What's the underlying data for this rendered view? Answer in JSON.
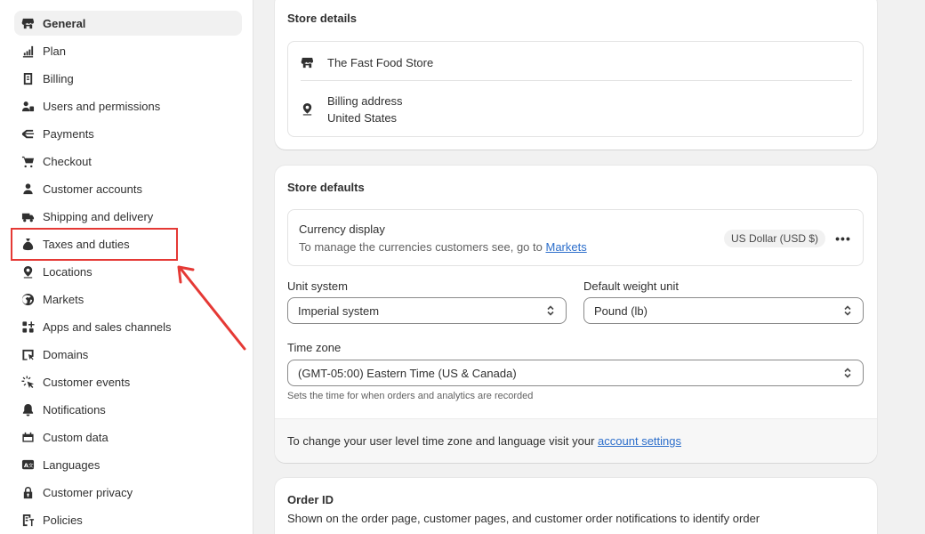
{
  "sidebar": {
    "items": [
      {
        "label": "General",
        "icon": "store-icon",
        "active": true
      },
      {
        "label": "Plan",
        "icon": "plan-chart-icon"
      },
      {
        "label": "Billing",
        "icon": "billing-icon"
      },
      {
        "label": "Users and permissions",
        "icon": "users-icon"
      },
      {
        "label": "Payments",
        "icon": "payments-icon"
      },
      {
        "label": "Checkout",
        "icon": "cart-icon"
      },
      {
        "label": "Customer accounts",
        "icon": "person-icon"
      },
      {
        "label": "Shipping and delivery",
        "icon": "truck-icon"
      },
      {
        "label": "Taxes and duties",
        "icon": "tax-bag-icon"
      },
      {
        "label": "Locations",
        "icon": "location-pin-icon"
      },
      {
        "label": "Markets",
        "icon": "globe-icon"
      },
      {
        "label": "Apps and sales channels",
        "icon": "apps-icon"
      },
      {
        "label": "Domains",
        "icon": "domain-icon"
      },
      {
        "label": "Customer events",
        "icon": "cursor-click-icon"
      },
      {
        "label": "Notifications",
        "icon": "bell-icon"
      },
      {
        "label": "Custom data",
        "icon": "custom-data-icon"
      },
      {
        "label": "Languages",
        "icon": "language-icon"
      },
      {
        "label": "Customer privacy",
        "icon": "lock-icon"
      },
      {
        "label": "Policies",
        "icon": "policies-icon"
      }
    ],
    "highlight_color": "#e53935"
  },
  "store_details": {
    "title": "Store details",
    "store_name": "The Fast Food Store",
    "billing_label": "Billing address",
    "billing_country": "United States"
  },
  "store_defaults": {
    "title": "Store defaults",
    "currency_label": "Currency display",
    "currency_help_prefix": "To manage the currencies customers see, go to ",
    "currency_help_link": "Markets",
    "currency_badge": "US Dollar (USD $)",
    "more_label": "•••",
    "unit_system_label": "Unit system",
    "unit_system_value": "Imperial system",
    "weight_unit_label": "Default weight unit",
    "weight_unit_value": "Pound (lb)",
    "time_zone_label": "Time zone",
    "time_zone_value": "(GMT-05:00) Eastern Time (US & Canada)",
    "time_zone_help": "Sets the time for when orders and analytics are recorded",
    "footer_prefix": "To change your user level time zone and language visit your ",
    "footer_link": "account settings"
  },
  "order_id": {
    "title": "Order ID",
    "description": "Shown on the order page, customer pages, and customer order notifications to identify order"
  },
  "colors": {
    "link": "#2c6ecb",
    "annotation": "#e53935"
  }
}
